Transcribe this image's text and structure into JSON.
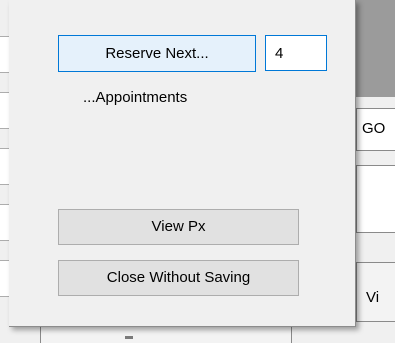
{
  "popup": {
    "reserve_button_label": "Reserve Next...",
    "count_input_value": "4",
    "appointments_label": "...Appointments",
    "view_px_button_label": "View Px",
    "close_button_label": "Close Without Saving"
  },
  "background_window": {
    "right_button_fragment": "GO",
    "right_bottom_button_fragment": "Vi"
  },
  "colors": {
    "focus_border": "#0078d7",
    "focus_fill": "#e5f1fb",
    "button_fill": "#e1e1e1",
    "panel_bg": "#f0f0f0"
  }
}
